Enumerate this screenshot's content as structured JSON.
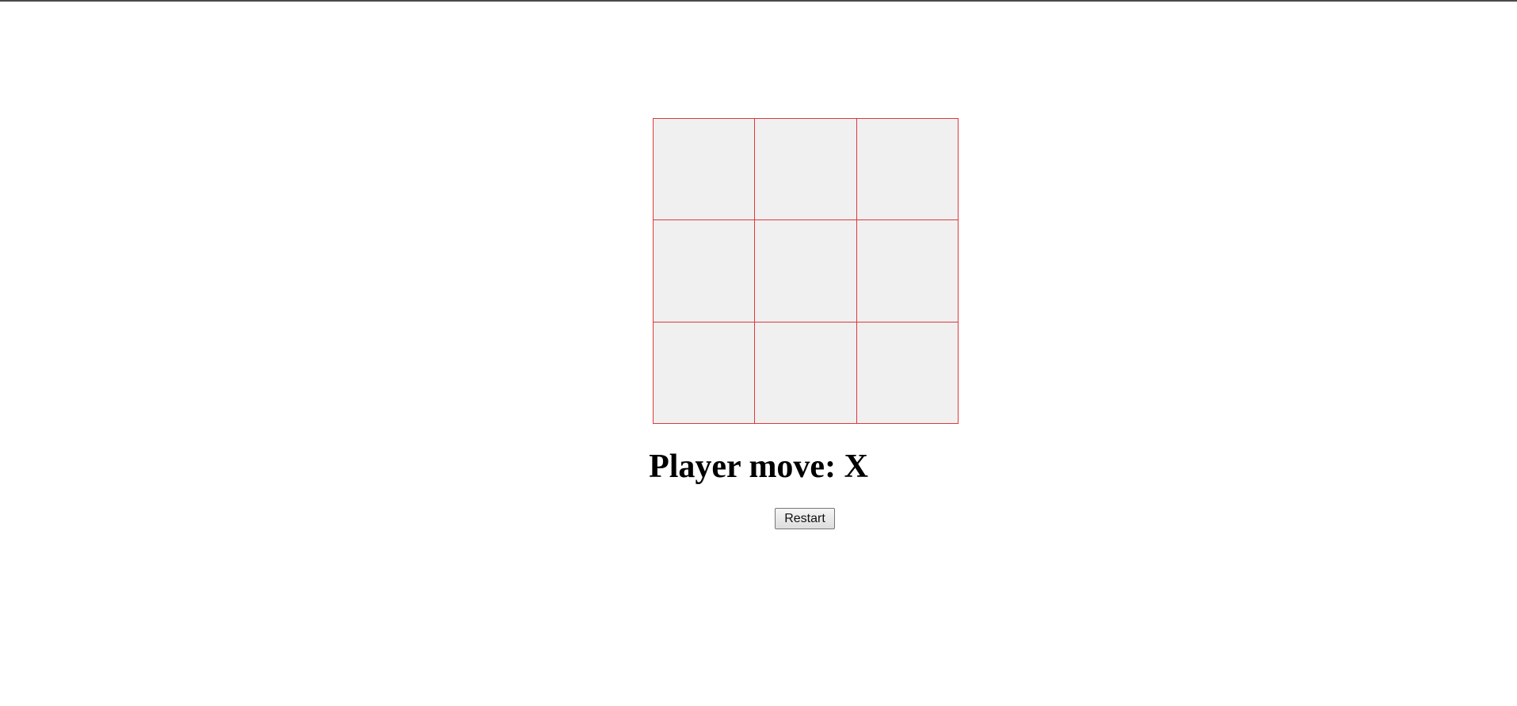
{
  "game": {
    "board": [
      "",
      "",
      "",
      "",
      "",
      "",
      "",
      "",
      ""
    ],
    "status_prefix": "Player move:",
    "current_player": "X",
    "restart_label": "Restart"
  },
  "colors": {
    "grid_line": "#e0383c",
    "cell_background": "#f0f0f0"
  }
}
